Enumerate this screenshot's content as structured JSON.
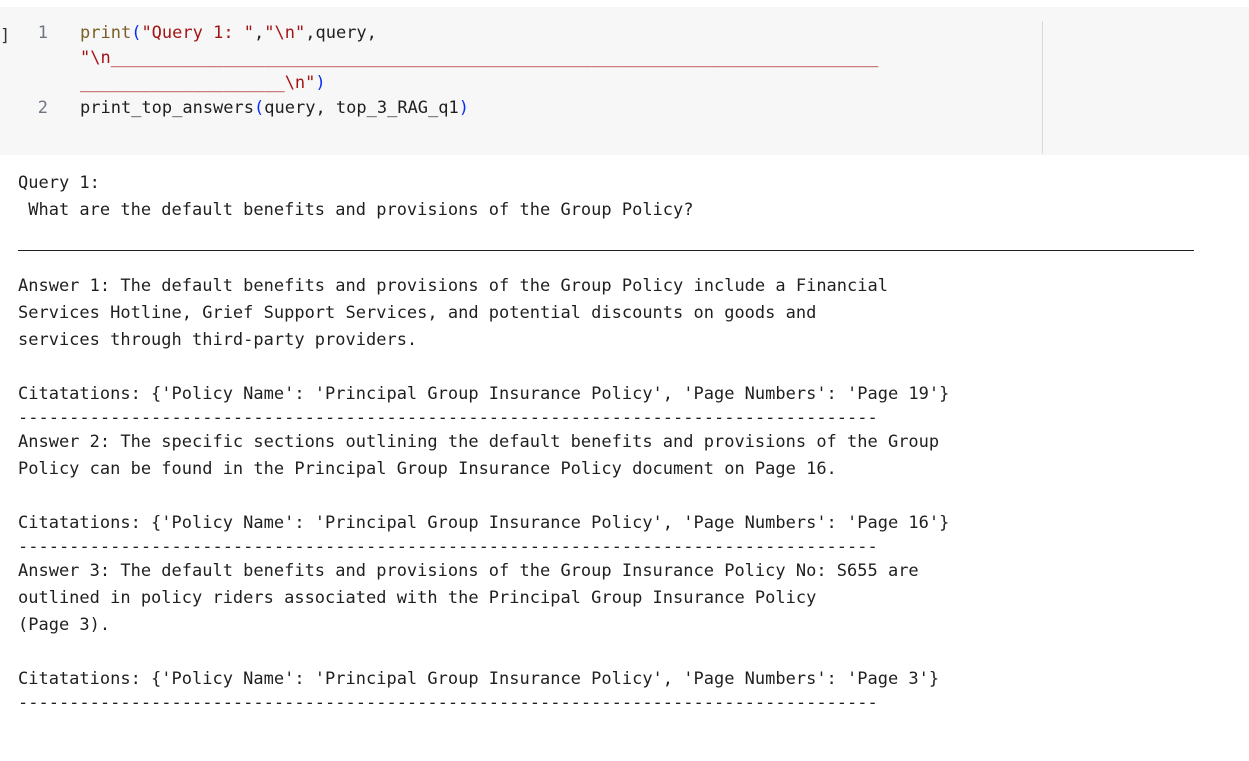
{
  "cell": {
    "bracket": "]",
    "lines": [
      {
        "number": "1",
        "fn": "print",
        "open": "(",
        "s1": "\"Query 1: \"",
        "comma1": ",",
        "s2": "\"\\n\"",
        "comma2": ",",
        "arg": "query",
        "comma3": ","
      },
      {
        "number": "",
        "s3": "\"\\n___________________________________________________________________________"
      },
      {
        "number": "",
        "s4": "____________________\\n\"",
        "close": ")"
      },
      {
        "number": "2",
        "fn": "print_top_answers",
        "open": "(",
        "arg1": "query",
        "sep": ", ",
        "arg2": "top_3_RAG_q1",
        "close": ")"
      }
    ]
  },
  "output": {
    "query_header": "Query 1:",
    "query_text": " What are the default benefits and provisions of the Group Policy?",
    "answers": [
      {
        "lines": [
          "Answer 1: The default benefits and provisions of the Group Policy include a Financial",
          "Services Hotline, Grief Support Services, and potential discounts on goods and",
          "services through third-party providers."
        ],
        "citation": "Citatations: {'Policy Name': 'Principal Group Insurance Policy', 'Page Numbers': 'Page 19'}",
        "separator": "------------------------------------------------------------------------------------"
      },
      {
        "lines": [
          "Answer 2: The specific sections outlining the default benefits and provisions of the Group",
          "Policy can be found in the Principal Group Insurance Policy document on Page 16."
        ],
        "citation": "Citatations: {'Policy Name': 'Principal Group Insurance Policy', 'Page Numbers': 'Page 16'}",
        "separator": "------------------------------------------------------------------------------------"
      },
      {
        "lines": [
          "Answer 3: The default benefits and provisions of the Group Insurance Policy No: S655 are",
          "outlined in policy riders associated with the Principal Group Insurance Policy",
          "(Page 3)."
        ],
        "citation": "Citatations: {'Policy Name': 'Principal Group Insurance Policy', 'Page Numbers': 'Page 3'}",
        "separator": "------------------------------------------------------------------------------------"
      }
    ]
  }
}
